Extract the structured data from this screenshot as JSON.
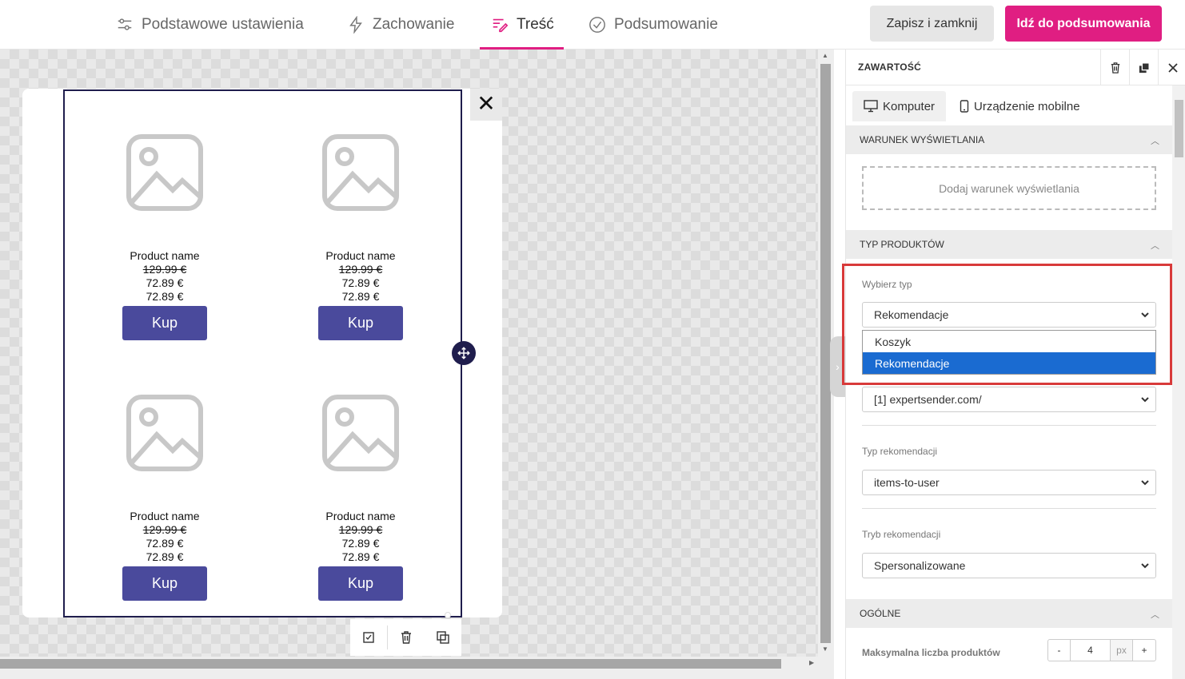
{
  "tabs": [
    {
      "label": "Podstawowe ustawienia",
      "icon": "sliders-icon"
    },
    {
      "label": "Zachowanie",
      "icon": "lightning-icon"
    },
    {
      "label": "Treść",
      "icon": "content-icon",
      "active": true
    },
    {
      "label": "Podsumowanie",
      "icon": "check-circle-icon"
    }
  ],
  "header": {
    "save_label": "Zapisz i zamknij",
    "summary_label": "Idź do podsumowania"
  },
  "colors": {
    "accent": "#e01e82",
    "button": "#4a4a9c",
    "frame": "#1f1d4d",
    "selected": "#1a6bd1",
    "highlight": "#d83a3a"
  },
  "products": [
    {
      "name": "Product name",
      "old_price": "129.99 €",
      "price": "72.89 €",
      "price2": "72.89 €",
      "button": "Kup"
    },
    {
      "name": "Product name",
      "old_price": "129.99 €",
      "price": "72.89 €",
      "price2": "72.89 €",
      "button": "Kup"
    },
    {
      "name": "Product name",
      "old_price": "129.99 €",
      "price": "72.89 €",
      "price2": "72.89 €",
      "button": "Kup"
    },
    {
      "name": "Product name",
      "old_price": "129.99 €",
      "price": "72.89 €",
      "price2": "72.89 €",
      "button": "Kup"
    }
  ],
  "panel": {
    "title": "ZAWARTOŚĆ",
    "device_tabs": [
      "Komputer",
      "Urządzenie mobilne"
    ],
    "display_condition": {
      "title": "Warunek wyświetlania",
      "add_label": "Dodaj warunek wyświetlania"
    },
    "product_type": {
      "title": "Typ produktów",
      "label": "Wybierz typ",
      "selected": "Rekomendacje",
      "options": [
        "Koszyk",
        "Rekomendacje"
      ]
    },
    "site_select": "[1] expertsender.com/",
    "rec_type": {
      "label": "Typ rekomendacji",
      "value": "items-to-user"
    },
    "rec_mode": {
      "label": "Tryb rekomendacji",
      "value": "Spersonalizowane"
    },
    "general": {
      "title": "Ogólne",
      "max_label": "Maksymalna liczba produktów",
      "max_value": "4",
      "unit": "px",
      "minus": "-",
      "plus": "+"
    }
  }
}
